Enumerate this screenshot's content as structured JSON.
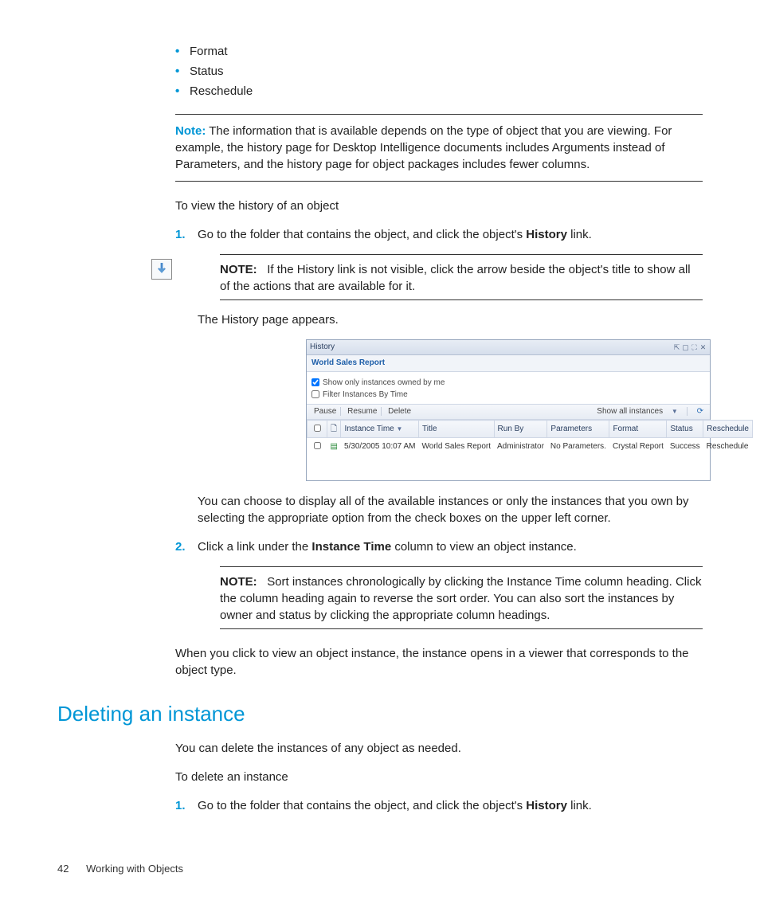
{
  "bullets": {
    "0": "Format",
    "1": "Status",
    "2": "Reschedule"
  },
  "note1": {
    "label": "Note:",
    "text": "The information that is available depends on the type of object that you are viewing. For example, the history page for Desktop Intelligence documents includes Arguments instead of Parameters, and the history page for object packages includes fewer columns."
  },
  "intro_view": "To view the history of an object",
  "step1": {
    "pre": "Go to the folder that contains the object, and click the object's ",
    "bold": "History",
    "post": " link."
  },
  "note2": {
    "label": "NOTE:",
    "text": "If the History link is not visible, click the arrow beside the object's title to show all of the actions that are available for it."
  },
  "history_appears": "The History page appears.",
  "screenshot": {
    "title": "History",
    "subtitle": "World Sales Report",
    "filter_owned": "Show only instances owned by me",
    "filter_time": "Filter Instances By Time",
    "toolbar": {
      "pause": "Pause",
      "resume": "Resume",
      "delete": "Delete",
      "showall": "Show all instances"
    },
    "cols": {
      "check": "",
      "icon": "",
      "time": "Instance Time",
      "title": "Title",
      "runby": "Run By",
      "params": "Parameters",
      "format": "Format",
      "status": "Status",
      "resched": "Reschedule"
    },
    "row": {
      "time": "5/30/2005 10:07 AM",
      "title": "World Sales Report",
      "runby": "Administrator",
      "params": "No Parameters.",
      "format": "Crystal Report",
      "status": "Success",
      "resched": "Reschedule"
    }
  },
  "after_shot": "You can choose to display all of the available instances or only the instances that you own by selecting the appropriate option from the check boxes on the upper left corner.",
  "step2": {
    "pre": "Click a link under the ",
    "bold": "Instance Time",
    "post": " column to view an object instance."
  },
  "note3": {
    "label": "NOTE:",
    "text": "Sort instances chronologically by clicking the Instance Time column heading. Click the column heading again to reverse the sort order. You can also sort the instances by owner and status by clicking the appropriate column headings."
  },
  "viewer_para": "When you click to view an object instance, the instance opens in a viewer that corresponds to the object type.",
  "section_heading": "Deleting an instance",
  "delete_intro": "You can delete the instances of any object as needed.",
  "delete_to": "To delete an instance",
  "del_step1": {
    "pre": "Go to the folder that contains the object, and click the object's ",
    "bold": "History",
    "post": " link."
  },
  "footer": {
    "page": "42",
    "chapter": "Working with Objects"
  }
}
